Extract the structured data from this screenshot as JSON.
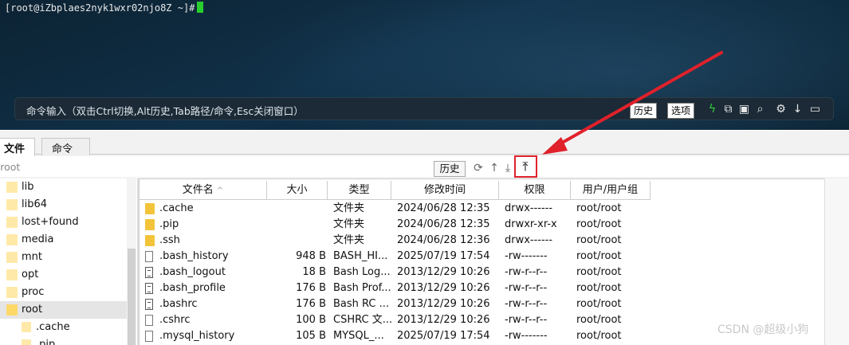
{
  "terminal": {
    "prompt": "[root@iZbplaes2nyk1wxr02njo8Z ~]#",
    "command_hint": "命令输入（双击Ctrl切换,Alt历史,Tab路径/命令,Esc关闭窗口）",
    "history_button": "历史",
    "options_button": "选项",
    "icons": [
      "lightning-icon",
      "copy-icon",
      "paste-icon",
      "search-icon",
      "gear-icon",
      "arrow-down-icon",
      "window-icon"
    ]
  },
  "tabs": [
    {
      "label": "文件",
      "active": true
    },
    {
      "label": "命令",
      "active": false
    }
  ],
  "pathbar": {
    "path": "/root",
    "history_button": "历史",
    "icons": [
      "refresh-icon",
      "up-icon",
      "download-icon",
      "upload-icon"
    ]
  },
  "tree": [
    {
      "label": "lib",
      "depth": 0
    },
    {
      "label": "lib64",
      "depth": 0
    },
    {
      "label": "lost+found",
      "depth": 0
    },
    {
      "label": "media",
      "depth": 0
    },
    {
      "label": "mnt",
      "depth": 0
    },
    {
      "label": "opt",
      "depth": 0
    },
    {
      "label": "proc",
      "depth": 0
    },
    {
      "label": "root",
      "depth": 0,
      "selected": true
    },
    {
      "label": ".cache",
      "depth": 1
    },
    {
      "label": ".pip",
      "depth": 1
    }
  ],
  "columns": [
    "文件名",
    "大小",
    "类型",
    "修改时间",
    "权限",
    "用户/用户组"
  ],
  "files": [
    {
      "name": ".cache",
      "size": "",
      "type": "文件夹",
      "mtime": "2024/06/28 12:35",
      "perm": "drwx------",
      "owner": "root/root",
      "icon": "folder"
    },
    {
      "name": ".pip",
      "size": "",
      "type": "文件夹",
      "mtime": "2024/06/28 12:35",
      "perm": "drwxr-xr-x",
      "owner": "root/root",
      "icon": "folder"
    },
    {
      "name": ".ssh",
      "size": "",
      "type": "文件夹",
      "mtime": "2024/06/28 12:36",
      "perm": "drwx------",
      "owner": "root/root",
      "icon": "folder"
    },
    {
      "name": ".bash_history",
      "size": "948 B",
      "type": "BASH_HI...",
      "mtime": "2025/07/19 17:54",
      "perm": "-rw-------",
      "owner": "root/root",
      "icon": "file"
    },
    {
      "name": ".bash_logout",
      "size": "18 B",
      "type": "Bash Log...",
      "mtime": "2013/12/29 10:26",
      "perm": "-rw-r--r--",
      "owner": "root/root",
      "icon": "doc"
    },
    {
      "name": ".bash_profile",
      "size": "176 B",
      "type": "Bash Prof...",
      "mtime": "2013/12/29 10:26",
      "perm": "-rw-r--r--",
      "owner": "root/root",
      "icon": "doc"
    },
    {
      "name": ".bashrc",
      "size": "176 B",
      "type": "Bash RC ...",
      "mtime": "2013/12/29 10:26",
      "perm": "-rw-r--r--",
      "owner": "root/root",
      "icon": "doc"
    },
    {
      "name": ".cshrc",
      "size": "100 B",
      "type": "CSHRC 文...",
      "mtime": "2013/12/29 10:26",
      "perm": "-rw-r--r--",
      "owner": "root/root",
      "icon": "file"
    },
    {
      "name": ".mysql_history",
      "size": "105 B",
      "type": "MYSQL_...",
      "mtime": "2025/07/19 17:54",
      "perm": "-rw-------",
      "owner": "root/root",
      "icon": "file"
    }
  ],
  "watermark": "CSDN @超级小狗",
  "colors": {
    "annotation": "#e0212b",
    "cursor": "#27d02d"
  }
}
